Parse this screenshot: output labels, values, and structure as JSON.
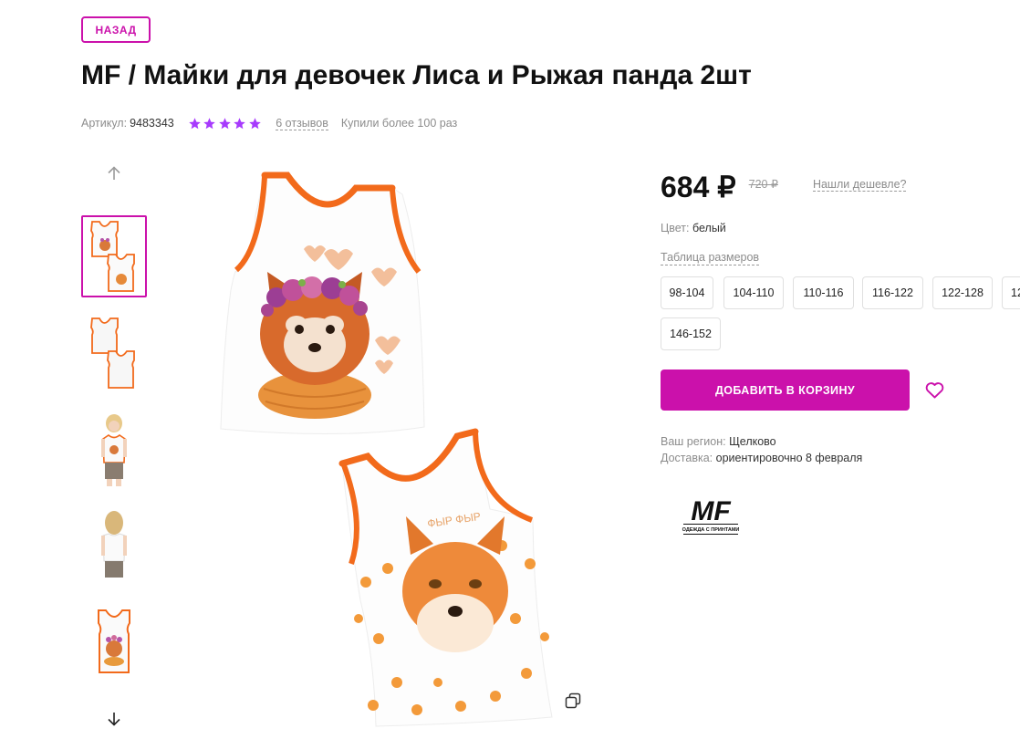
{
  "nav": {
    "back_label": "НАЗАД"
  },
  "product": {
    "title": "MF / Майки для девочек Лиса и Рыжая панда 2шт",
    "sku_label": "Артикул:",
    "sku_value": "9483343",
    "rating": 5,
    "reviews_label": "6 отзывов",
    "bought_label": "Купили более 100 раз"
  },
  "price": {
    "current": "684 ₽",
    "old": "720 ₽",
    "cheaper_label": "Нашли дешевле?"
  },
  "color": {
    "label": "Цвет:",
    "value": "белый"
  },
  "size_table_label": "Таблица размеров",
  "sizes": [
    "98-104",
    "104-110",
    "110-116",
    "116-122",
    "122-128",
    "12",
    "146-152"
  ],
  "actions": {
    "add_to_cart_label": "ДОБАВИТЬ В КОРЗИНУ"
  },
  "delivery": {
    "region_label": "Ваш регион:",
    "region_value": "Щелково",
    "delivery_label": "Доставка:",
    "delivery_value": "ориентировочно 8 февраля"
  },
  "brand": {
    "logo_text": "MF",
    "logo_subtitle": "ОДЕЖДА С ПРИНТАМИ"
  },
  "image_text": {
    "print_caption": "ФЫР ФЫР"
  },
  "colors": {
    "accent": "#cb11ab",
    "star": "#a73afd",
    "trim": "#f26a1b"
  },
  "icons": {
    "arrow_up": "arrow-up-icon",
    "arrow_down": "arrow-down-icon",
    "heart": "heart-icon",
    "copy": "copy-icon",
    "star": "star-icon"
  }
}
